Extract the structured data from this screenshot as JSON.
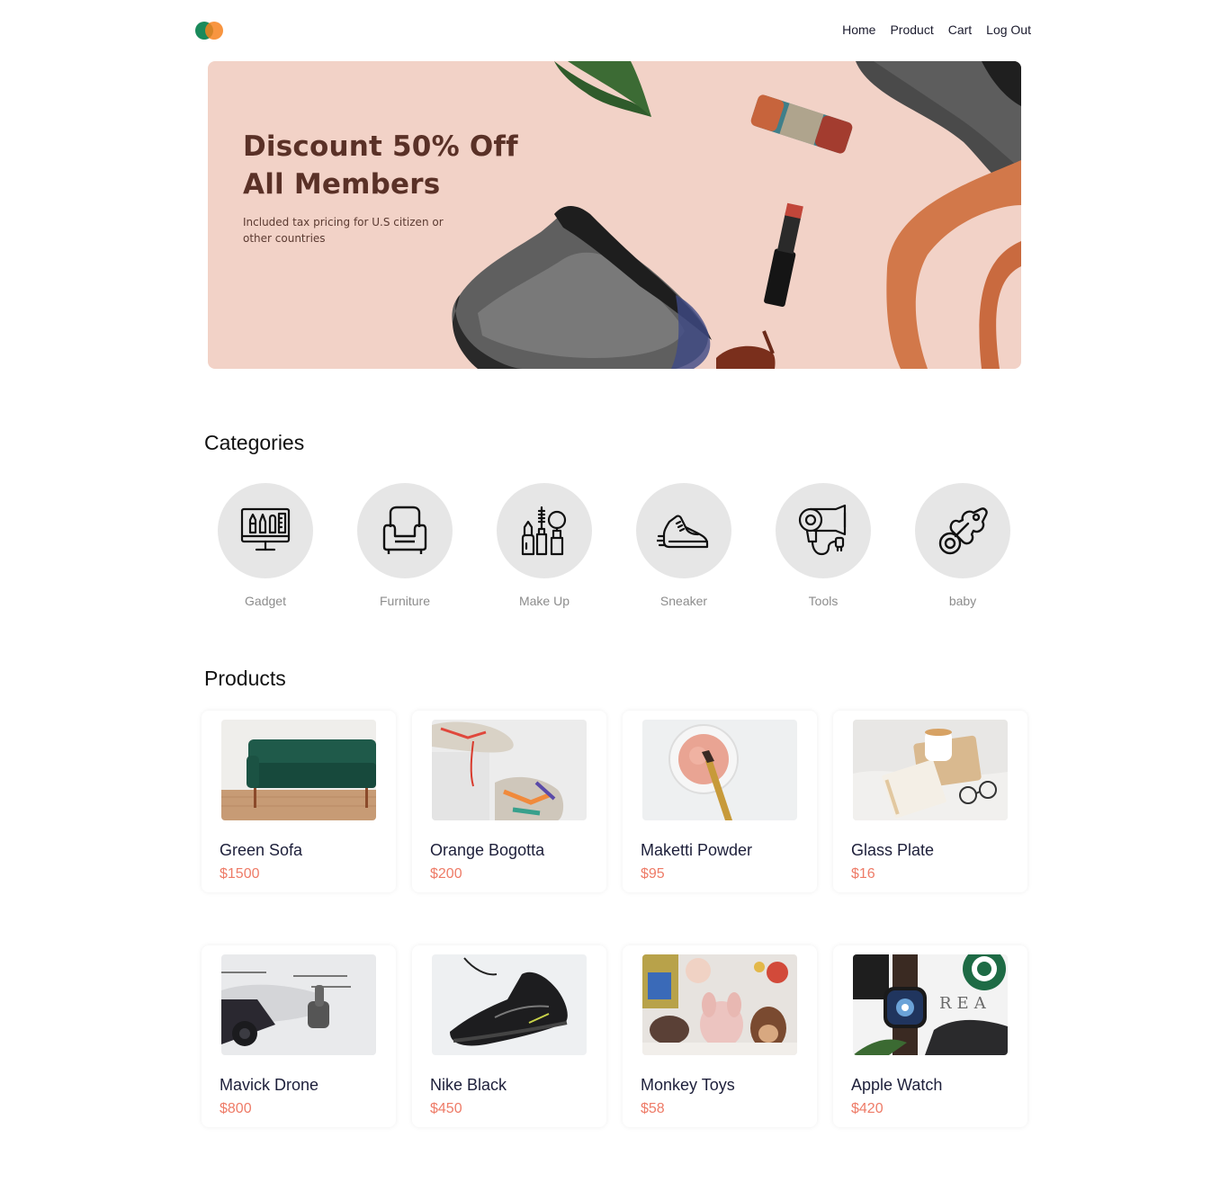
{
  "nav": {
    "links": [
      "Home",
      "Product",
      "Cart",
      "Log Out"
    ]
  },
  "hero": {
    "headline_line1": "Discount 50% Off",
    "headline_line2": "All Members",
    "subtext_line1": "Included tax pricing for U.S citizen or",
    "subtext_line2": "other countries"
  },
  "categories": {
    "title": "Categories",
    "items": [
      {
        "label": "Gadget",
        "icon": "monitor-tools-icon"
      },
      {
        "label": "Furniture",
        "icon": "armchair-icon"
      },
      {
        "label": "Make Up",
        "icon": "makeup-icon"
      },
      {
        "label": "Sneaker",
        "icon": "sneaker-icon"
      },
      {
        "label": "Tools",
        "icon": "hair-dryer-icon"
      },
      {
        "label": "baby",
        "icon": "pacifier-icon"
      }
    ]
  },
  "products": {
    "title": "Products",
    "items": [
      {
        "name": "Green Sofa",
        "price": "$1500"
      },
      {
        "name": "Orange Bogotta",
        "price": "$200"
      },
      {
        "name": "Maketti Powder",
        "price": "$95"
      },
      {
        "name": "Glass Plate",
        "price": "$16"
      },
      {
        "name": "Mavick Drone",
        "price": "$800"
      },
      {
        "name": "Nike Black",
        "price": "$450"
      },
      {
        "name": "Monkey Toys",
        "price": "$58"
      },
      {
        "name": "Apple Watch",
        "price": "$420"
      }
    ]
  },
  "colors": {
    "logo_green": "#1a8a5b",
    "logo_orange": "#f7821f",
    "price": "#ee7b67",
    "hero_bg": "#f2d2c7",
    "category_circle": "#e6e6e6"
  }
}
